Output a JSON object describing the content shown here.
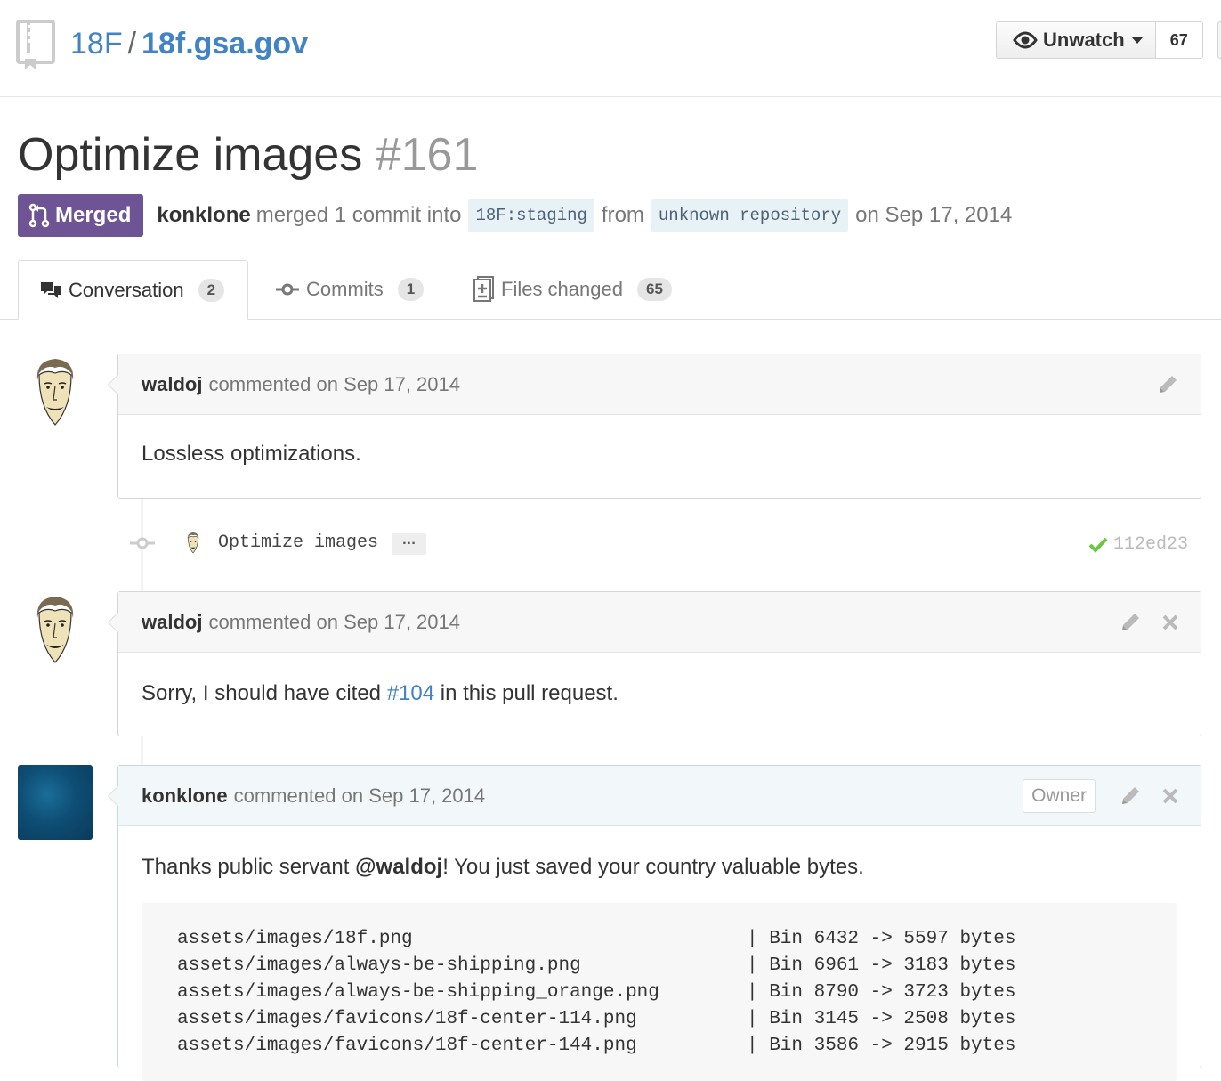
{
  "repo": {
    "owner": "18F",
    "separator": "/",
    "name": "18f.gsa.gov"
  },
  "watch": {
    "label": "Unwatch",
    "count": "67"
  },
  "pr": {
    "title": "Optimize images",
    "number": "#161",
    "state": "Merged",
    "author": "konklone",
    "merged_text": "merged 1 commit into",
    "base_branch": "18F:staging",
    "from_text": "from",
    "head_branch": "unknown repository",
    "date_text": "on Sep 17, 2014"
  },
  "tabs": [
    {
      "label": "Conversation",
      "count": "2"
    },
    {
      "label": "Commits",
      "count": "1"
    },
    {
      "label": "Files changed",
      "count": "65"
    }
  ],
  "comments": [
    {
      "author": "waldoj",
      "meta": "commented on Sep 17, 2014",
      "body": "Lossless optimizations."
    },
    {
      "author": "waldoj",
      "meta": "commented on Sep 17, 2014",
      "body_before": "Sorry, I should have cited ",
      "link": "#104",
      "body_after": " in this pull request."
    },
    {
      "author": "konklone",
      "meta": "commented on Sep 17, 2014",
      "badge": "Owner",
      "body_before": "Thanks public servant ",
      "mention": "@waldoj",
      "body_after": "! You just saved your country valuable bytes."
    }
  ],
  "commit": {
    "message": "Optimize images",
    "more": "…",
    "sha": "112ed23"
  },
  "code_lines": [
    {
      "path": "assets/images/18f.png",
      "info": "| Bin 6432 -> 5597 bytes"
    },
    {
      "path": "assets/images/always-be-shipping.png",
      "info": "| Bin 6961 -> 3183 bytes"
    },
    {
      "path": "assets/images/always-be-shipping_orange.png",
      "info": "| Bin 8790 -> 3723 bytes"
    },
    {
      "path": "assets/images/favicons/18f-center-114.png",
      "info": "| Bin 3145 -> 2508 bytes"
    },
    {
      "path": "assets/images/favicons/18f-center-144.png",
      "info": "| Bin 3586 -> 2915 bytes"
    }
  ],
  "colors": {
    "merged": "#6e5494",
    "link": "#4183c4",
    "success": "#6cc644"
  },
  "icons": [
    "repo-icon",
    "eye-icon",
    "merge-icon",
    "comment-discussion-icon",
    "commit-icon",
    "diff-icon",
    "pencil-icon",
    "close-icon",
    "check-icon"
  ]
}
